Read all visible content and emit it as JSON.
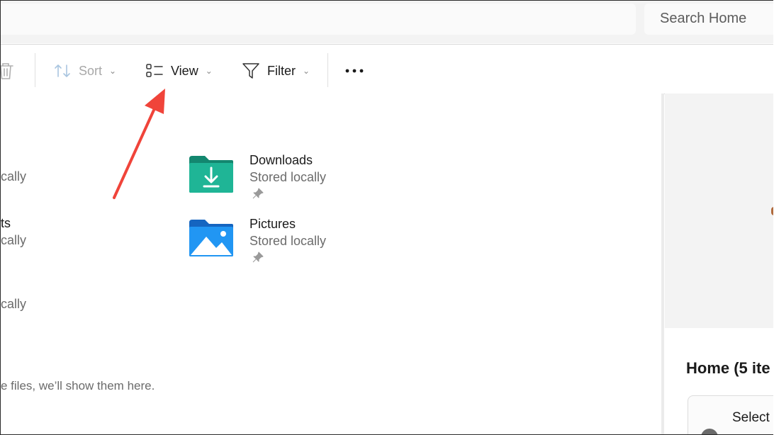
{
  "search": {
    "placeholder": "Search Home"
  },
  "toolbar": {
    "sort_label": "Sort",
    "view_label": "View",
    "filter_label": "Filter"
  },
  "content": {
    "left_fragments": [
      "cally",
      "ts",
      "cally",
      "cally"
    ],
    "folders": [
      {
        "name": "Downloads",
        "status": "Stored locally",
        "icon": "downloads-folder-icon"
      },
      {
        "name": "Pictures",
        "status": "Stored locally",
        "icon": "pictures-folder-icon"
      }
    ],
    "empty_message": "e files, we’ll show them here."
  },
  "details": {
    "title": "Home (5 ite",
    "info_text": "Select"
  },
  "colors": {
    "annotation_arrow": "#f0443a",
    "downloads_folder": "#1aa88f",
    "pictures_folder": "#1e88e5"
  }
}
